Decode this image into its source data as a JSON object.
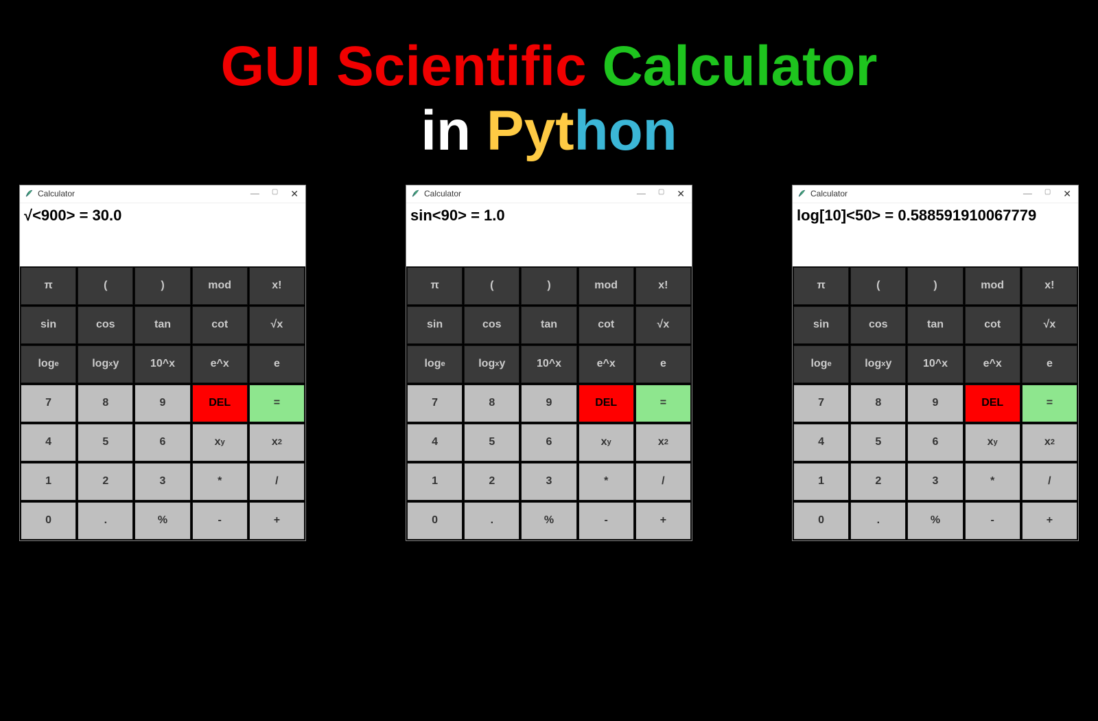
{
  "heading": {
    "part1": "GUI Scientific",
    "part2": "Calculator",
    "part3": "in",
    "part4": "Pyt",
    "part5": "hon"
  },
  "windows": [
    {
      "title": "Calculator",
      "display": "√<900> = 30.0"
    },
    {
      "title": "Calculator",
      "display": "sin<90> = 1.0"
    },
    {
      "title": "Calculator",
      "display": "log[10]<50> = 0.588591910067779"
    }
  ],
  "buttons": [
    [
      {
        "label": "π",
        "cls": "btn-dark",
        "name": "pi-button"
      },
      {
        "label": "(",
        "cls": "btn-dark",
        "name": "open-paren-button"
      },
      {
        "label": ")",
        "cls": "btn-dark",
        "name": "close-paren-button"
      },
      {
        "label": "mod",
        "cls": "btn-dark",
        "name": "mod-button"
      },
      {
        "label": "x!",
        "cls": "btn-dark",
        "name": "factorial-button"
      }
    ],
    [
      {
        "label": "sin",
        "cls": "btn-dark",
        "name": "sin-button"
      },
      {
        "label": "cos",
        "cls": "btn-dark",
        "name": "cos-button"
      },
      {
        "label": "tan",
        "cls": "btn-dark",
        "name": "tan-button"
      },
      {
        "label": "cot",
        "cls": "btn-dark",
        "name": "cot-button"
      },
      {
        "label": "√x",
        "cls": "btn-dark",
        "name": "sqrt-button"
      }
    ],
    [
      {
        "label": "logₑ",
        "cls": "btn-dark",
        "name": "ln-button",
        "html": "log<span class='sub'>e</span>"
      },
      {
        "label": "logₓy",
        "cls": "btn-dark",
        "name": "logxy-button",
        "html": "log<span class='sub'>x</span>y"
      },
      {
        "label": "10^x",
        "cls": "btn-dark",
        "name": "ten-pow-x-button"
      },
      {
        "label": "e^x",
        "cls": "btn-dark",
        "name": "e-pow-x-button"
      },
      {
        "label": "e",
        "cls": "btn-dark",
        "name": "e-button"
      }
    ],
    [
      {
        "label": "7",
        "cls": "btn-light",
        "name": "digit-7-button"
      },
      {
        "label": "8",
        "cls": "btn-light",
        "name": "digit-8-button"
      },
      {
        "label": "9",
        "cls": "btn-light",
        "name": "digit-9-button"
      },
      {
        "label": "DEL",
        "cls": "btn-del",
        "name": "delete-button"
      },
      {
        "label": "=",
        "cls": "btn-eq",
        "name": "equals-button"
      }
    ],
    [
      {
        "label": "4",
        "cls": "btn-light",
        "name": "digit-4-button"
      },
      {
        "label": "5",
        "cls": "btn-light",
        "name": "digit-5-button"
      },
      {
        "label": "6",
        "cls": "btn-light",
        "name": "digit-6-button"
      },
      {
        "label": "xʸ",
        "cls": "btn-light",
        "name": "x-pow-y-button",
        "html": "x<span class='sup'>y</span>"
      },
      {
        "label": "x²",
        "cls": "btn-light",
        "name": "x-squared-button",
        "html": "x<span class='sup'>2</span>"
      }
    ],
    [
      {
        "label": "1",
        "cls": "btn-light",
        "name": "digit-1-button"
      },
      {
        "label": "2",
        "cls": "btn-light",
        "name": "digit-2-button"
      },
      {
        "label": "3",
        "cls": "btn-light",
        "name": "digit-3-button"
      },
      {
        "label": "*",
        "cls": "btn-light",
        "name": "multiply-button"
      },
      {
        "label": "/",
        "cls": "btn-light",
        "name": "divide-button"
      }
    ],
    [
      {
        "label": "0",
        "cls": "btn-light",
        "name": "digit-0-button"
      },
      {
        "label": ".",
        "cls": "btn-light",
        "name": "decimal-button"
      },
      {
        "label": "%",
        "cls": "btn-light",
        "name": "percent-button"
      },
      {
        "label": "-",
        "cls": "btn-light",
        "name": "subtract-button"
      },
      {
        "label": "+",
        "cls": "btn-light",
        "name": "add-button"
      }
    ]
  ],
  "window_controls": {
    "minimize": "—",
    "maximize": "▢",
    "close": "✕"
  },
  "feather_icon": "🪶"
}
